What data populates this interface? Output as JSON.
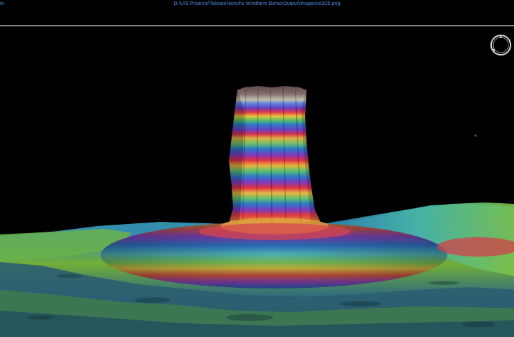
{
  "window": {
    "title_left": "m",
    "file_path": "D:\\UIS Projects\\Taiwan\\Hsinchu Windfarm Demo\\Output\\Images\\st3D5.png"
  },
  "icons": {
    "compass": "compass-icon"
  },
  "colors": {
    "background": "#000000",
    "title_text": "#4a90e2",
    "separator": "#8a8a8a"
  }
}
